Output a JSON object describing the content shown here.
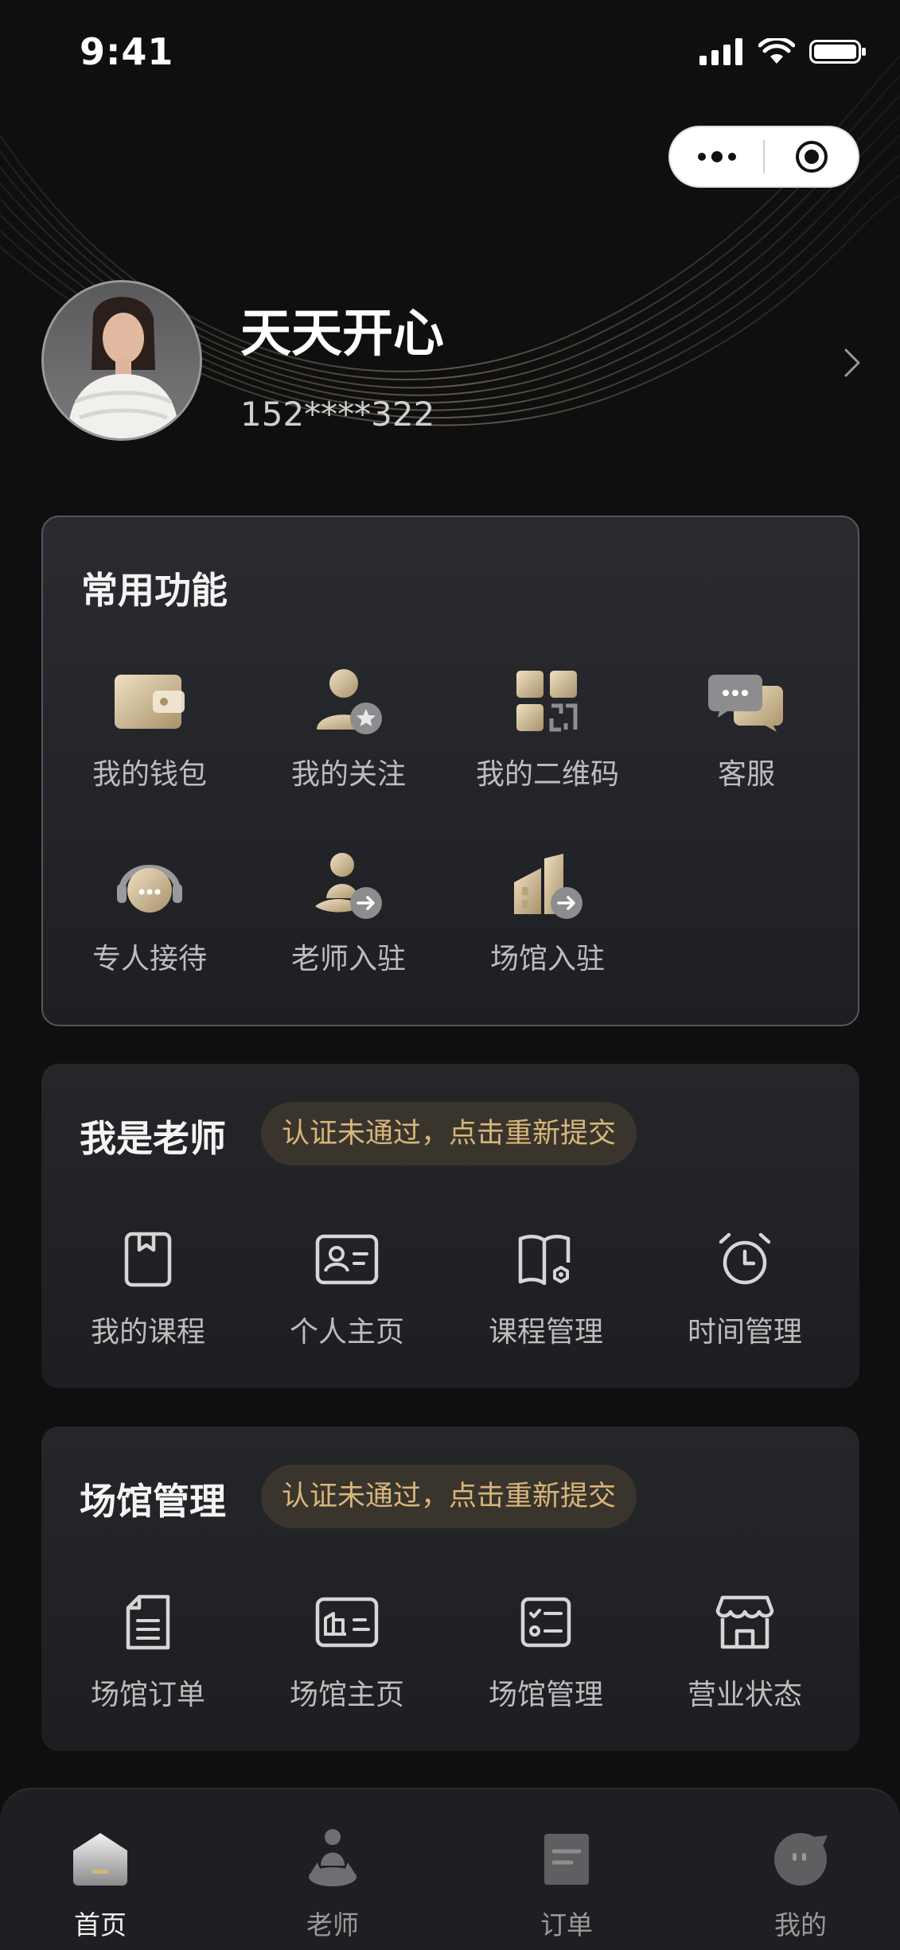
{
  "status_bar": {
    "time": "9:41"
  },
  "profile": {
    "nickname": "天天开心",
    "phone": "152****322"
  },
  "common": {
    "title": "常用功能",
    "items": [
      {
        "label": "我的钱包",
        "icon": "wallet-icon"
      },
      {
        "label": "我的关注",
        "icon": "follow-icon"
      },
      {
        "label": "我的二维码",
        "icon": "qrcode-icon"
      },
      {
        "label": "客服",
        "icon": "customer-service-icon"
      },
      {
        "label": "专人接待",
        "icon": "reception-icon"
      },
      {
        "label": "老师入驻",
        "icon": "teacher-join-icon"
      },
      {
        "label": "场馆入驻",
        "icon": "venue-join-icon"
      }
    ]
  },
  "teacher": {
    "title": "我是老师",
    "badge": "认证未通过，点击重新提交",
    "items": [
      {
        "label": "我的课程",
        "icon": "course-icon"
      },
      {
        "label": "个人主页",
        "icon": "profile-card-icon"
      },
      {
        "label": "课程管理",
        "icon": "course-manage-icon"
      },
      {
        "label": "时间管理",
        "icon": "alarm-clock-icon"
      }
    ]
  },
  "venue": {
    "title": "场馆管理",
    "badge": "认证未通过，点击重新提交",
    "items": [
      {
        "label": "场馆订单",
        "icon": "venue-order-icon"
      },
      {
        "label": "场馆主页",
        "icon": "venue-home-icon"
      },
      {
        "label": "场馆管理",
        "icon": "venue-manage-icon"
      },
      {
        "label": "营业状态",
        "icon": "store-icon"
      }
    ]
  },
  "tabbar": {
    "items": [
      {
        "label": "首页",
        "icon": "home-icon",
        "active": true
      },
      {
        "label": "老师",
        "icon": "teacher-icon"
      },
      {
        "label": "订单",
        "icon": "order-icon"
      },
      {
        "label": "我的",
        "icon": "mine-icon"
      }
    ]
  },
  "colors": {
    "accent_gold": "#d8b57c",
    "background": "#0f0f10",
    "card": "#25262a"
  }
}
